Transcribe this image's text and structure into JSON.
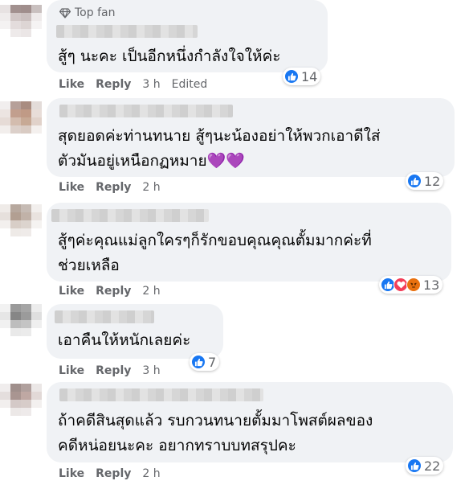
{
  "comments": [
    {
      "badge": "Top fan",
      "text_lines": [
        "สู้ๆ นะคะ เป็นอีกหนึ่งกำลังใจให้ค่ะ"
      ],
      "like_label": "Like",
      "reply_label": "Reply",
      "time": "3 h",
      "edited": "Edited",
      "reaction_count": "14",
      "reactions": [
        "like-icon"
      ]
    },
    {
      "text_lines": [
        "สุดยอดค่ะท่านทนาย สู้ๆนะน้องอย่าให้พวกเอาดีใส่",
        "ตัวมันอยู่เหนือกฏหมาย💜💜"
      ],
      "like_label": "Like",
      "reply_label": "Reply",
      "time": "2 h",
      "reaction_count": "12",
      "reactions": [
        "like-icon"
      ]
    },
    {
      "text_lines": [
        "สู้ๆค่ะคุณแม่ลูกใครๆก็รักขอบคุณคุณตั้มมากค่ะที่",
        "ช่วยเหลือ"
      ],
      "like_label": "Like",
      "reply_label": "Reply",
      "time": "2 h",
      "reaction_count": "13",
      "reactions": [
        "like-icon",
        "love-icon",
        "angry-icon"
      ]
    },
    {
      "text_lines": [
        "เอาคืนให้หนักเลยค่ะ"
      ],
      "like_label": "Like",
      "reply_label": "Reply",
      "time": "3 h",
      "reaction_count": "7",
      "reactions": [
        "like-icon"
      ]
    },
    {
      "text_lines": [
        "ถ้าคดีสินสุดแล้ว รบกวนทนายตั้มมาโพสต์ผลของ",
        "คดีหน่อยนะคะ อยากทราบบทสรุปคะ"
      ],
      "like_label": "Like",
      "reply_label": "Reply",
      "time": "2 h",
      "reaction_count": "22",
      "reactions": [
        "like-icon"
      ]
    }
  ],
  "colors": {
    "bubble": "#f0f2f5",
    "meta_text": "#65676b",
    "like_blue": "#1877f2",
    "love_red": "#f33e58",
    "angry_orange": "#e9710f"
  }
}
